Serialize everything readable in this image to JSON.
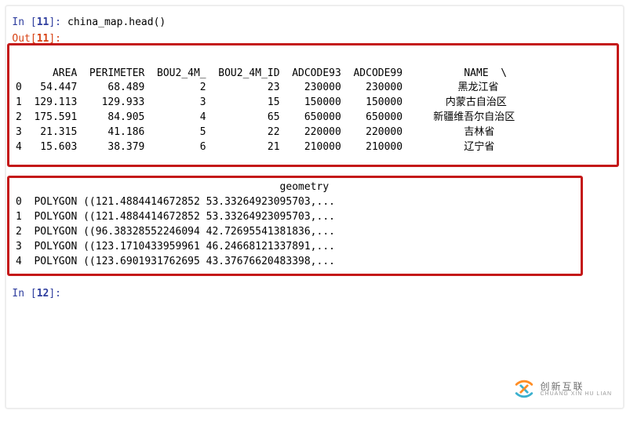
{
  "cells": {
    "in11": {
      "prompt_label": "In [",
      "prompt_num": "11",
      "prompt_close": "]:",
      "code": "china_map.head()"
    },
    "out11": {
      "prompt_label": "Out[",
      "prompt_num": "11",
      "prompt_close": "]:"
    },
    "in12": {
      "prompt_label": "In [",
      "prompt_num": "12",
      "prompt_close": "]:",
      "code": ""
    }
  },
  "table1": {
    "header": "      AREA  PERIMETER  BOU2_4M_  BOU2_4M_ID  ADCODE93  ADCODE99          NAME  \\",
    "rows": [
      "0   54.447     68.489         2          23    230000    230000         黑龙江省",
      "1  129.113    129.933         3          15    150000    150000       内蒙古自治区",
      "2  175.591     84.905         4          65    650000    650000     新疆维吾尔自治区",
      "3   21.315     41.186         5          22    220000    220000          吉林省",
      "4   15.603     38.379         6          21    210000    210000          辽宁省"
    ]
  },
  "table2": {
    "header": "                                           geometry",
    "rows": [
      "0  POLYGON ((121.4884414672852 53.33264923095703,...",
      "1  POLYGON ((121.4884414672852 53.33264923095703,...",
      "2  POLYGON ((96.38328552246094 42.72695541381836,...",
      "3  POLYGON ((123.1710433959961 46.24668121337891,...",
      "4  POLYGON ((123.6901931762695 43.37676620483398,..."
    ]
  },
  "watermark": {
    "main": "创新互联",
    "sub": "CHUANG XIN HU LIAN"
  },
  "chart_data": {
    "type": "table",
    "title": "china_map.head()",
    "columns": [
      "AREA",
      "PERIMETER",
      "BOU2_4M_",
      "BOU2_4M_ID",
      "ADCODE93",
      "ADCODE99",
      "NAME",
      "geometry"
    ],
    "rows": [
      {
        "index": 0,
        "AREA": 54.447,
        "PERIMETER": 68.489,
        "BOU2_4M_": 2,
        "BOU2_4M_ID": 23,
        "ADCODE93": 230000,
        "ADCODE99": 230000,
        "NAME": "黑龙江省",
        "geometry": "POLYGON ((121.4884414672852 53.33264923095703,..."
      },
      {
        "index": 1,
        "AREA": 129.113,
        "PERIMETER": 129.933,
        "BOU2_4M_": 3,
        "BOU2_4M_ID": 15,
        "ADCODE93": 150000,
        "ADCODE99": 150000,
        "NAME": "内蒙古自治区",
        "geometry": "POLYGON ((121.4884414672852 53.33264923095703,..."
      },
      {
        "index": 2,
        "AREA": 175.591,
        "PERIMETER": 84.905,
        "BOU2_4M_": 4,
        "BOU2_4M_ID": 65,
        "ADCODE93": 650000,
        "ADCODE99": 650000,
        "NAME": "新疆维吾尔自治区",
        "geometry": "POLYGON ((96.38328552246094 42.72695541381836,..."
      },
      {
        "index": 3,
        "AREA": 21.315,
        "PERIMETER": 41.186,
        "BOU2_4M_": 5,
        "BOU2_4M_ID": 22,
        "ADCODE93": 220000,
        "ADCODE99": 220000,
        "NAME": "吉林省",
        "geometry": "POLYGON ((123.1710433959961 46.24668121337891,..."
      },
      {
        "index": 4,
        "AREA": 15.603,
        "PERIMETER": 38.379,
        "BOU2_4M_": 6,
        "BOU2_4M_ID": 21,
        "ADCODE93": 210000,
        "ADCODE99": 210000,
        "NAME": "辽宁省",
        "geometry": "POLYGON ((123.6901931762695 43.37676620483398,..."
      }
    ]
  }
}
